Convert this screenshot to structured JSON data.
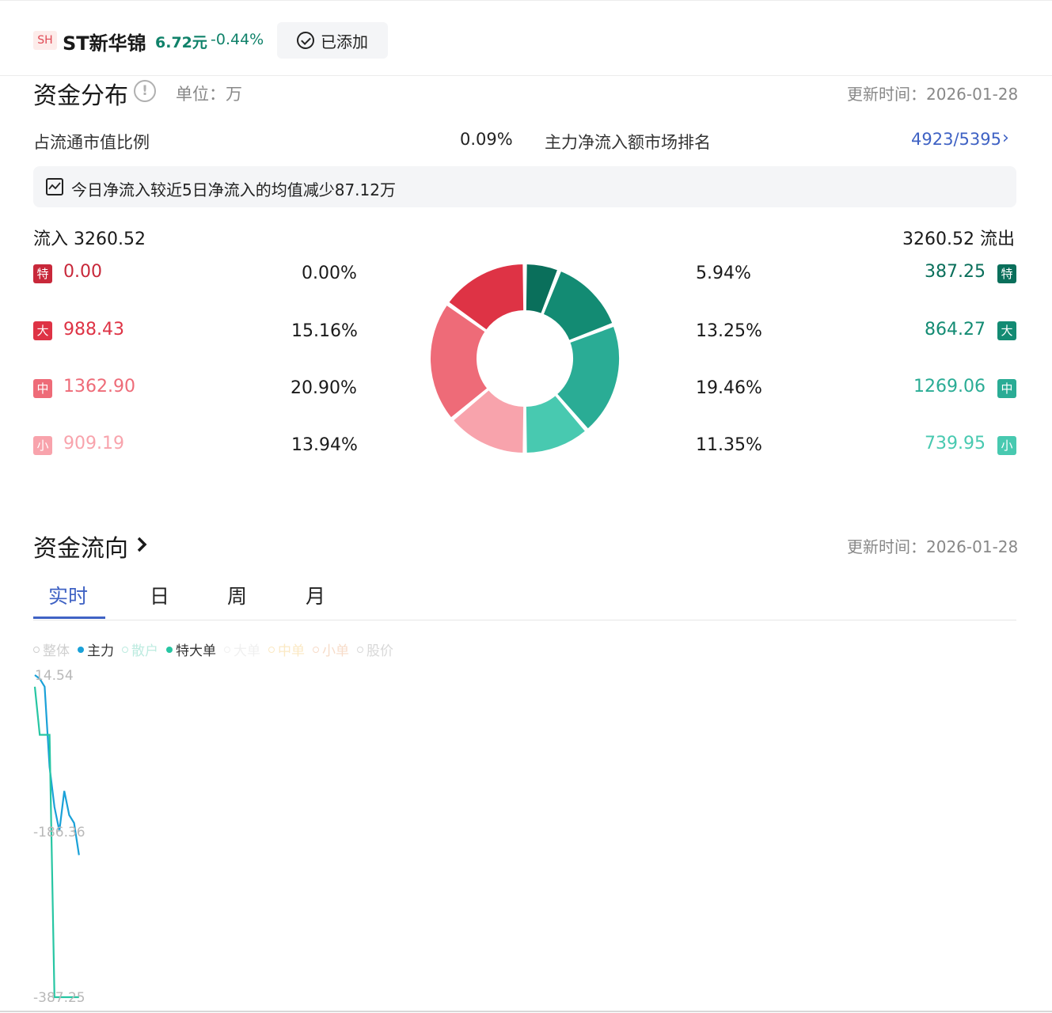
{
  "header": {
    "exchange": "SH",
    "name": "ST新华锦",
    "price": "6.72元",
    "change": "-0.44%",
    "added_label": "已添加"
  },
  "distribution": {
    "title": "资金分布",
    "unit": "单位：万",
    "updated": "更新时间：2026-01-28",
    "ratio_label": "占流通市值比例",
    "ratio_value": "0.09%",
    "rank_label": "主力净流入额市场排名",
    "rank_value": "4923/5395",
    "notice": "今日净流入较近5日净流入的均值减少87.12万",
    "inflow_label": "流入 3260.52",
    "outflow_label": "3260.52 流出",
    "rows": [
      {
        "tag": "特",
        "in_amt": "0.00",
        "in_pct": "0.00%",
        "out_pct": "5.94%",
        "out_amt": "387.25"
      },
      {
        "tag": "大",
        "in_amt": "988.43",
        "in_pct": "15.16%",
        "out_pct": "13.25%",
        "out_amt": "864.27"
      },
      {
        "tag": "中",
        "in_amt": "1362.90",
        "in_pct": "20.90%",
        "out_pct": "19.46%",
        "out_amt": "1269.06"
      },
      {
        "tag": "小",
        "in_amt": "909.19",
        "in_pct": "13.94%",
        "out_pct": "11.35%",
        "out_amt": "739.95"
      }
    ],
    "colors": {
      "in": [
        "#c8283a",
        "#de3345",
        "#ee6b78",
        "#f8a3ac"
      ],
      "out": [
        "#0a6f5b",
        "#138b73",
        "#2aac95",
        "#48c9b0"
      ]
    }
  },
  "chart_data": {
    "type": "pie",
    "labels": [
      "特(流入)",
      "大(流入)",
      "中(流入)",
      "小(流入)",
      "特(流出)",
      "大(流出)",
      "中(流出)",
      "小(流出)"
    ],
    "values": [
      0.0,
      15.16,
      20.9,
      13.94,
      5.94,
      13.25,
      19.46,
      11.35
    ]
  },
  "flow": {
    "title": "资金流向",
    "updated": "更新时间：2026-01-28",
    "tabs": [
      "实时",
      "日",
      "周",
      "月"
    ],
    "active_tab": 0,
    "legend": [
      {
        "label": "整体",
        "color": "#cfcfcf",
        "on": false
      },
      {
        "label": "主力",
        "color": "#1aa1d8",
        "on": true
      },
      {
        "label": "散户",
        "color": "#bdebe0",
        "on": false
      },
      {
        "label": "特大单",
        "color": "#27c6a3",
        "on": true
      },
      {
        "label": "大单",
        "color": "#f0f0f0",
        "on": false
      },
      {
        "label": "中单",
        "color": "#fbe9c4",
        "on": false
      },
      {
        "label": "小单",
        "color": "#f7dcc9",
        "on": false
      },
      {
        "label": "股价",
        "color": "#d8d8d8",
        "on": false
      }
    ],
    "y_max_label": "14.54",
    "y_mid_label": "-186.36",
    "y_min_label": "-387.25",
    "series": [
      {
        "name": "主力",
        "color": "#1aa1d8",
        "values": [
          14.54,
          10.0,
          0.0,
          -100.0,
          -150.0,
          -180.0,
          -130.0,
          -160.0,
          -170.0,
          -210.0
        ]
      },
      {
        "name": "特大单",
        "color": "#27c6a3",
        "values": [
          0.0,
          -60.0,
          -60.0,
          -60.0,
          -387.25,
          -387.25,
          -387.25,
          -387.25,
          -387.25,
          -387.25
        ]
      }
    ]
  }
}
